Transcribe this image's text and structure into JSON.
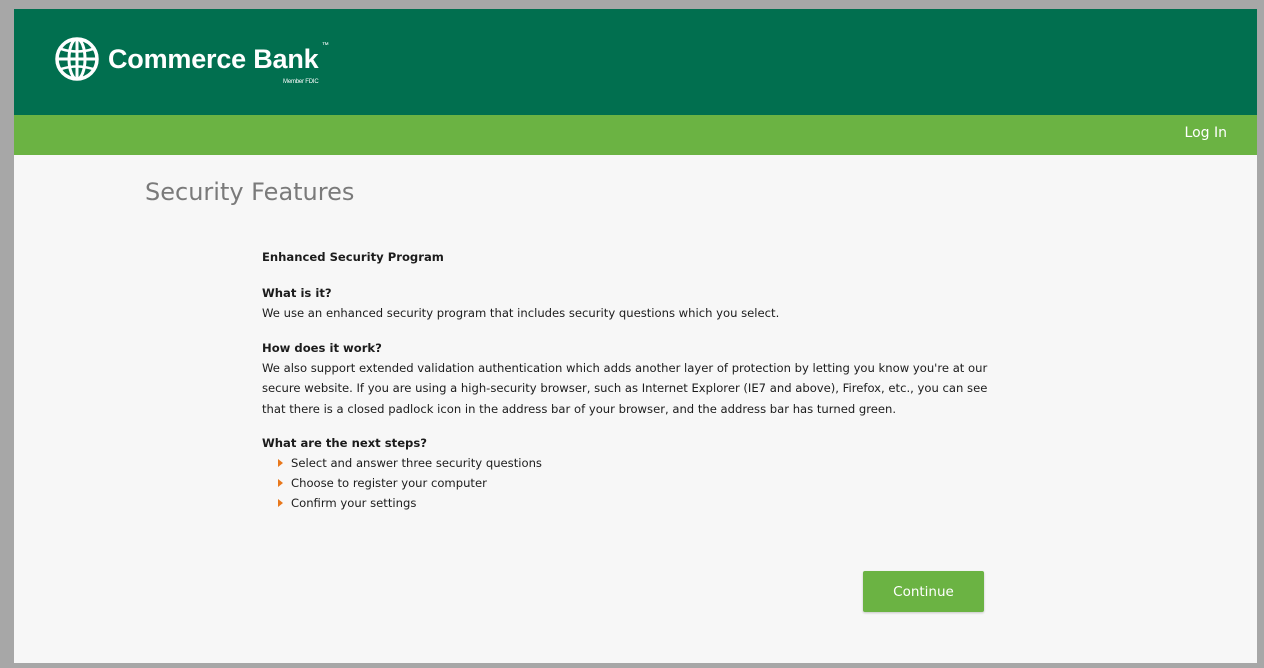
{
  "header": {
    "brand_name": "Commerce Bank",
    "brand_trademark": "™",
    "brand_tagline": "Member FDIC",
    "logo_icon": "globe-icon",
    "background_color": "#016f4f"
  },
  "nav": {
    "login_label": "Log In",
    "background_color": "#6bb343"
  },
  "page": {
    "title": "Security Features"
  },
  "content": {
    "program_title": "Enhanced Security Program",
    "what_heading": "What is it?",
    "what_text": "We use an enhanced security program that includes security questions which you select.",
    "how_heading": "How does it work?",
    "how_text": "We also support extended validation authentication which adds another layer of protection by letting you know you're at our secure website. If you are using a high-security browser, such as Internet Explorer (IE7 and above), Firefox, etc., you can see that there is a closed padlock icon in the address bar of your browser, and the address bar has turned green.",
    "next_heading": "What are the next steps?",
    "steps": [
      "Select and answer three security questions",
      "Choose to register your computer",
      "Confirm your settings"
    ],
    "bullet_icon": "orange-triangle-bullet-icon",
    "bullet_color": "#e8781c"
  },
  "actions": {
    "continue_label": "Continue",
    "button_color": "#6bb343"
  }
}
